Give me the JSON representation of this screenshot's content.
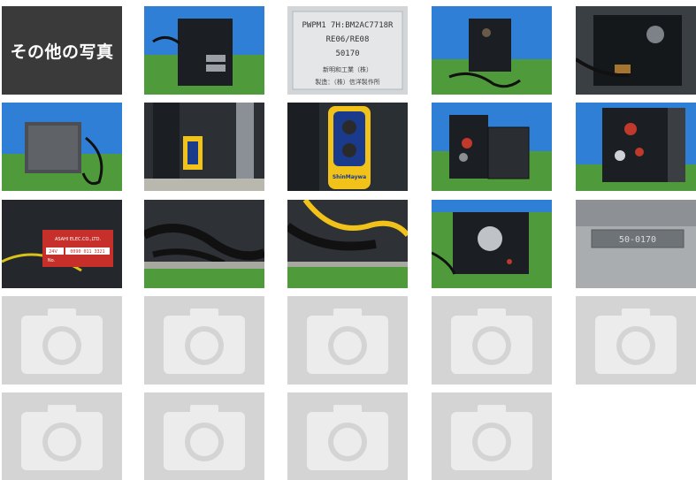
{
  "gallery": {
    "section_label": "その他の写真",
    "photo_icon": "camera-icon",
    "nameplate": {
      "line1": "PWPM1 7H:BM2AC7718R",
      "line2": "RE06/RE08",
      "line3": "50170",
      "line4": "新明和工業（株）",
      "line5": "製造：（株）信洋製作所"
    },
    "controller_brand": "ShinMaywa",
    "motor_label": {
      "maker": "ASAHI ELEC.CO.,LTD.",
      "voltage": "24V",
      "serial": "0090 011 3321",
      "no_label": "No."
    },
    "small_plate": "50-0170",
    "colors": {
      "sky_blue": "#2f7fd6",
      "grass": "#4f9a3a",
      "dark_box": "#1b1f24",
      "yellow": "#f0c21a",
      "placeholder_bg": "#d4d4d4",
      "placeholder_icon": "#ececec"
    }
  }
}
